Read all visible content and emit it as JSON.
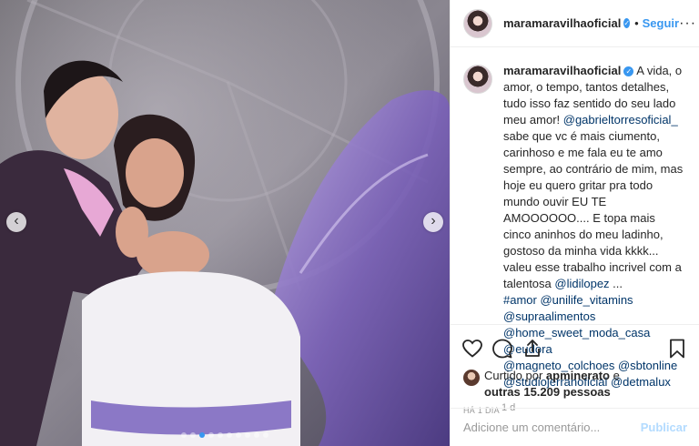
{
  "post": {
    "author": "maramaravilhaoficial",
    "separator": "•",
    "follow_label": "Seguir",
    "more_label": "···"
  },
  "caption": {
    "username": "maramaravilhaoficial",
    "text_1": " A vida, o amor, o tempo, tantos detalhes, tudo isso faz sentido do seu lado meu amor! ",
    "mention_1": "@gabrieltorresoficial_",
    "text_2": " sabe que vc é mais ciumento, carinhoso e me fala eu te amo sempre, ao contrário de mim, mas hoje eu quero gritar pra todo mundo ouvir EU TE AMOOOOOO.... E topa mais cinco aninhos do meu ladinho, gostoso da minha vida kkkk... valeu esse trabalho incrivel com a talentosa ",
    "mention_2": "@lidilopez",
    "text_3": " ...",
    "tags": [
      "#amor",
      "@unilife_vitamins",
      "@supraalimentos",
      "@home_sweet_moda_casa",
      "@eudora",
      "@magneto_colchoes",
      "@sbtonline",
      "@studiojerrahoficial",
      "@detmalux"
    ],
    "time": "1 d"
  },
  "likes": {
    "prefix": "Curtido por ",
    "first_user": "apminerato",
    "middle": " e ",
    "others": "outras 15.209 pessoas"
  },
  "date": "HÁ 1 DIA",
  "comment_box": {
    "placeholder": "Adicione um comentário...",
    "publish_label": "Publicar"
  },
  "carousel": {
    "prev_symbol": "‹",
    "next_symbol": "›",
    "slides": 10,
    "active_slide": 2
  },
  "colors": {
    "accent": "#3897f0",
    "link": "#003569",
    "muted": "#999999",
    "publish_disabled": "#b3dbff"
  },
  "icons": [
    "verified-icon",
    "heart-icon",
    "comment-icon",
    "share-icon",
    "bookmark-icon",
    "chevron-left-icon",
    "chevron-right-icon"
  ]
}
